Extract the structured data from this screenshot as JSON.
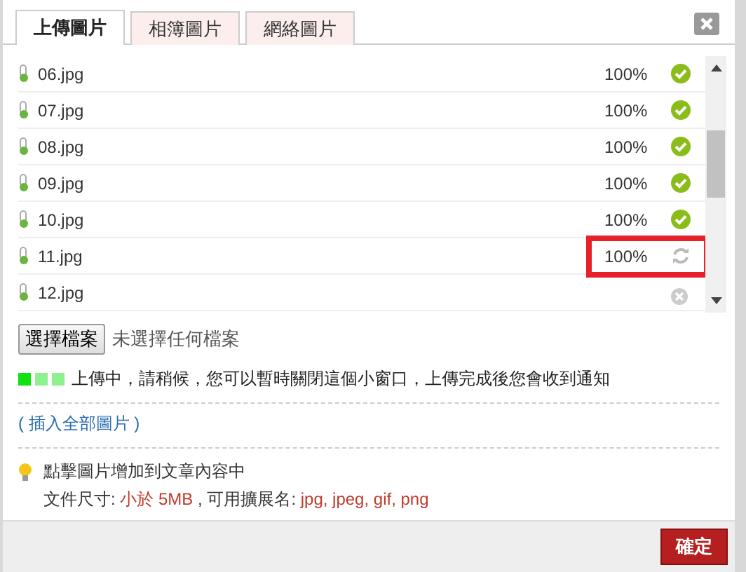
{
  "tabs": [
    {
      "label": "上傳圖片",
      "selected": true
    },
    {
      "label": "相簿圖片",
      "selected": false
    },
    {
      "label": "網絡圖片",
      "selected": false
    }
  ],
  "files": [
    {
      "name": "06.jpg",
      "progress": "100%",
      "kind": "done",
      "highlighted": false
    },
    {
      "name": "07.jpg",
      "progress": "100%",
      "kind": "done",
      "highlighted": false
    },
    {
      "name": "08.jpg",
      "progress": "100%",
      "kind": "done",
      "highlighted": false
    },
    {
      "name": "09.jpg",
      "progress": "100%",
      "kind": "done",
      "highlighted": false
    },
    {
      "name": "10.jpg",
      "progress": "100%",
      "kind": "done",
      "highlighted": false
    },
    {
      "name": "11.jpg",
      "progress": "100%",
      "kind": "syncing",
      "highlighted": true
    },
    {
      "name": "12.jpg",
      "kind": "failed",
      "highlighted": false
    }
  ],
  "file_input": {
    "button": "選擇檔案",
    "value": "未選擇任何檔案"
  },
  "upload_status": {
    "dots": [
      {
        "on": true
      },
      {
        "on": false
      },
      {
        "on": false
      }
    ],
    "message": "上傳中，請稍候，您可以暫時關閉這個小窗口，上傳完成後您會收到通知"
  },
  "insert_all_link": "( 插入全部圖片 )",
  "tip": {
    "line1": "點擊圖片增加到文章內容中",
    "size_label": "文件尺寸:",
    "size_value": "小於 5MB",
    "separator": ", 可用擴展名:",
    "extensions": "jpg, jpeg, gif, png"
  },
  "ok_button": "確定"
}
